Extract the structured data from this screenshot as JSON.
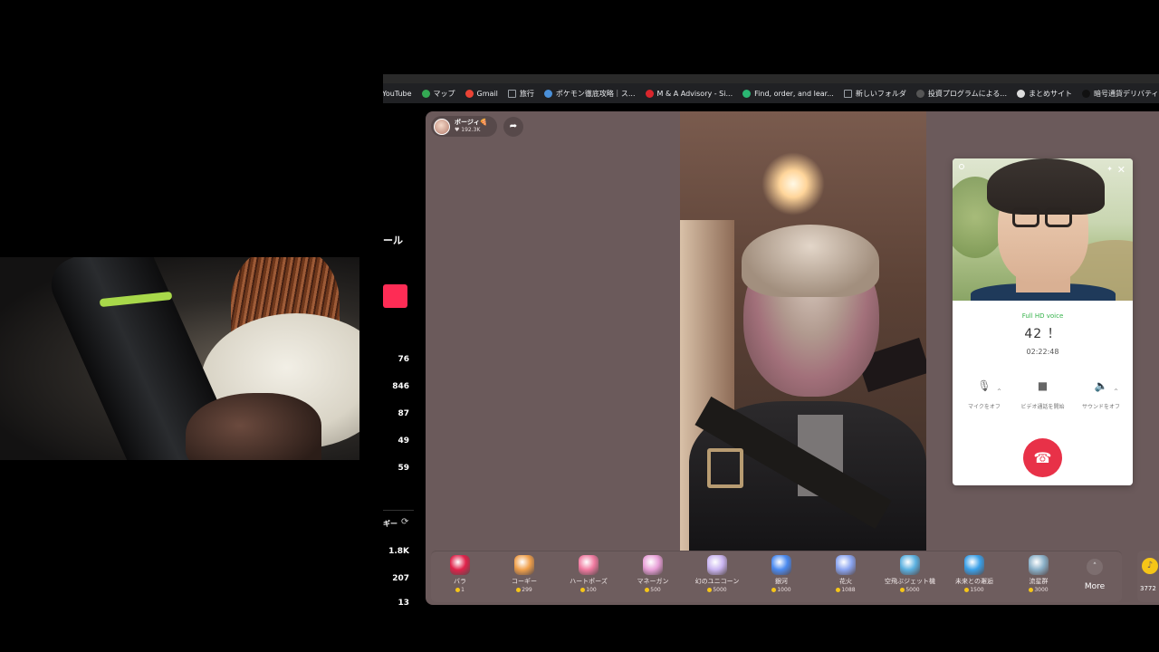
{
  "bookmarks": [
    {
      "label": "YouTube",
      "icon": "youtube-icon",
      "color": "#ff0000"
    },
    {
      "label": "マップ",
      "icon": "maps-icon",
      "color": "#34a853"
    },
    {
      "label": "Gmail",
      "icon": "gmail-icon",
      "color": "#ea4335"
    },
    {
      "label": "旅行",
      "icon": "folder-icon",
      "color": "#9aa0a6"
    },
    {
      "label": "ポケモン徹底攻略｜ス...",
      "icon": "site-icon",
      "color": "#4a90d9"
    },
    {
      "label": "M & A Advisory - Si...",
      "icon": "site-icon",
      "color": "#d9262c"
    },
    {
      "label": "Find, order, and lear...",
      "icon": "site-icon",
      "color": "#2bb673"
    },
    {
      "label": "新しいフォルダ",
      "icon": "folder-icon",
      "color": "#9aa0a6"
    },
    {
      "label": "投資プログラムによる...",
      "icon": "site-icon",
      "color": "#555555"
    },
    {
      "label": "まとめサイト",
      "icon": "globe-icon",
      "color": "#dddddd"
    },
    {
      "label": "暗号通貨デリバティブ...",
      "icon": "site-icon",
      "color": "#111111"
    }
  ],
  "strip": {
    "title": "ール",
    "numbers": [
      "76",
      "846",
      "87",
      "49",
      "59"
    ],
    "label": "ギー",
    "numbers2": [
      "1.8K",
      "207",
      "13"
    ]
  },
  "host": {
    "name": "ボージィ🍕",
    "likes": "♥ 192.3K"
  },
  "call": {
    "quality": "Full HD voice",
    "number": "42 ！",
    "duration": "02:22:48",
    "controls": [
      {
        "label": "マイクをオフ",
        "icon": "microphone-icon"
      },
      {
        "label": "ビデオ通話を開始",
        "icon": "video-camera-icon"
      },
      {
        "label": "サウンドをオフ",
        "icon": "speaker-icon"
      }
    ]
  },
  "gifts": [
    {
      "name": "バラ",
      "price": "1",
      "color": "#e0224a"
    },
    {
      "name": "コーギー",
      "price": "299",
      "color": "#f0a04b"
    },
    {
      "name": "ハートポーズ",
      "price": "100",
      "color": "#f07aa0"
    },
    {
      "name": "マネーガン",
      "price": "500",
      "color": "#e8a0d8"
    },
    {
      "name": "幻のユニコーン",
      "price": "5000",
      "color": "#c9b4f0"
    },
    {
      "name": "銀河",
      "price": "1000",
      "color": "#4a8af0"
    },
    {
      "name": "花火",
      "price": "1088",
      "color": "#8aa4f0"
    },
    {
      "name": "空飛ぶジェット機",
      "price": "5000",
      "color": "#5ab0e0"
    },
    {
      "name": "未来との邂逅",
      "price": "1500",
      "color": "#3aa0e8"
    },
    {
      "name": "流星群",
      "price": "3000",
      "color": "#8ab0c8"
    }
  ],
  "more_label": "More",
  "coin_balance": "3772"
}
